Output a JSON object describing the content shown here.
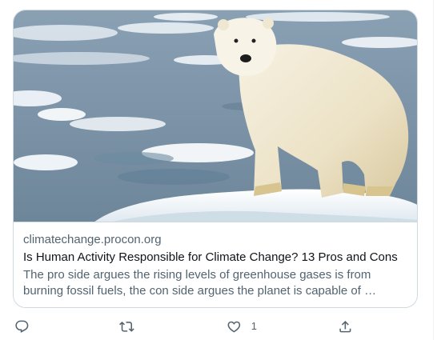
{
  "card": {
    "domain": "climatechange.procon.org",
    "title": "Is Human Activity Responsible for Climate Change? 13 Pros and Cons",
    "description": "The pro side argues the rising levels of greenhouse gases is from burning fossil fuels, the con side argues the planet is capable of …",
    "image": "polar-bear-on-ice-floe"
  },
  "actions": {
    "reply": {
      "icon": "reply-icon",
      "count": ""
    },
    "retweet": {
      "icon": "retweet-icon",
      "count": ""
    },
    "like": {
      "icon": "heart-icon",
      "count": "1"
    },
    "share": {
      "icon": "share-icon",
      "count": ""
    }
  }
}
